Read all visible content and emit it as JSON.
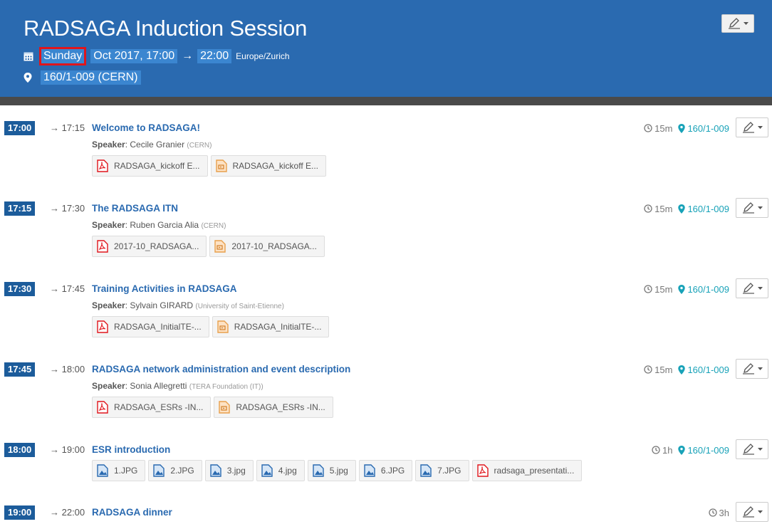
{
  "event": {
    "title": "RADSAGA Induction Session",
    "day": "Sunday",
    "date_rest": "Oct 2017, 17:00",
    "arrow": "→",
    "end_time": "22:00",
    "timezone": "Europe/Zurich",
    "location": "160/1-009 (CERN)"
  },
  "colors": {
    "header": "#2a6ab0",
    "time_badge": "#1c5c9b",
    "room": "#18a2b8",
    "pdf": "#e0151b",
    "pptx": "#e8a04c",
    "image": "#2a6ab0"
  },
  "entries": [
    {
      "start": "17:00",
      "end": "→ 17:15",
      "title": "Welcome to RADSAGA!",
      "speaker_label": "Speaker",
      "speaker": ": Cecile Granier",
      "affiliation": "(CERN)",
      "duration": "15m",
      "room": "160/1-009",
      "files": [
        {
          "type": "pdf",
          "name": "RADSAGA_kickoff E..."
        },
        {
          "type": "pptx",
          "name": "RADSAGA_kickoff E..."
        }
      ]
    },
    {
      "start": "17:15",
      "end": "→ 17:30",
      "title": "The RADSAGA ITN",
      "speaker_label": "Speaker",
      "speaker": ": Ruben Garcia Alia",
      "affiliation": "(CERN)",
      "duration": "15m",
      "room": "160/1-009",
      "files": [
        {
          "type": "pdf",
          "name": "2017-10_RADSAGA..."
        },
        {
          "type": "pptx",
          "name": "2017-10_RADSAGA..."
        }
      ]
    },
    {
      "start": "17:30",
      "end": "→ 17:45",
      "title": "Training Activities in RADSAGA",
      "speaker_label": "Speaker",
      "speaker": ": Sylvain GIRARD",
      "affiliation": "(University of Saint-Etienne)",
      "duration": "15m",
      "room": "160/1-009",
      "files": [
        {
          "type": "pdf",
          "name": "RADSAGA_InitialTE-..."
        },
        {
          "type": "pptx",
          "name": "RADSAGA_InitialTE-..."
        }
      ]
    },
    {
      "start": "17:45",
      "end": "→ 18:00",
      "title": "RADSAGA network administration and event description",
      "speaker_label": "Speaker",
      "speaker": ": Sonia Allegretti",
      "affiliation": "(TERA Foundation (IT))",
      "duration": "15m",
      "room": "160/1-009",
      "files": [
        {
          "type": "pdf",
          "name": "RADSAGA_ESRs -IN..."
        },
        {
          "type": "pptx",
          "name": "RADSAGA_ESRs -IN..."
        }
      ]
    },
    {
      "start": "18:00",
      "end": "→ 19:00",
      "title": "ESR introduction",
      "duration": "1h",
      "room": "160/1-009",
      "files": [
        {
          "type": "image",
          "name": "1.JPG"
        },
        {
          "type": "image",
          "name": "2.JPG"
        },
        {
          "type": "image",
          "name": "3.jpg"
        },
        {
          "type": "image",
          "name": "4.jpg"
        },
        {
          "type": "image",
          "name": "5.jpg"
        },
        {
          "type": "image",
          "name": "6.JPG"
        },
        {
          "type": "image",
          "name": "7.JPG"
        },
        {
          "type": "pdf",
          "name": "radsaga_presentati..."
        }
      ]
    },
    {
      "start": "19:00",
      "end": "→ 22:00",
      "title": "RADSAGA dinner",
      "duration": "3h",
      "files": []
    }
  ]
}
